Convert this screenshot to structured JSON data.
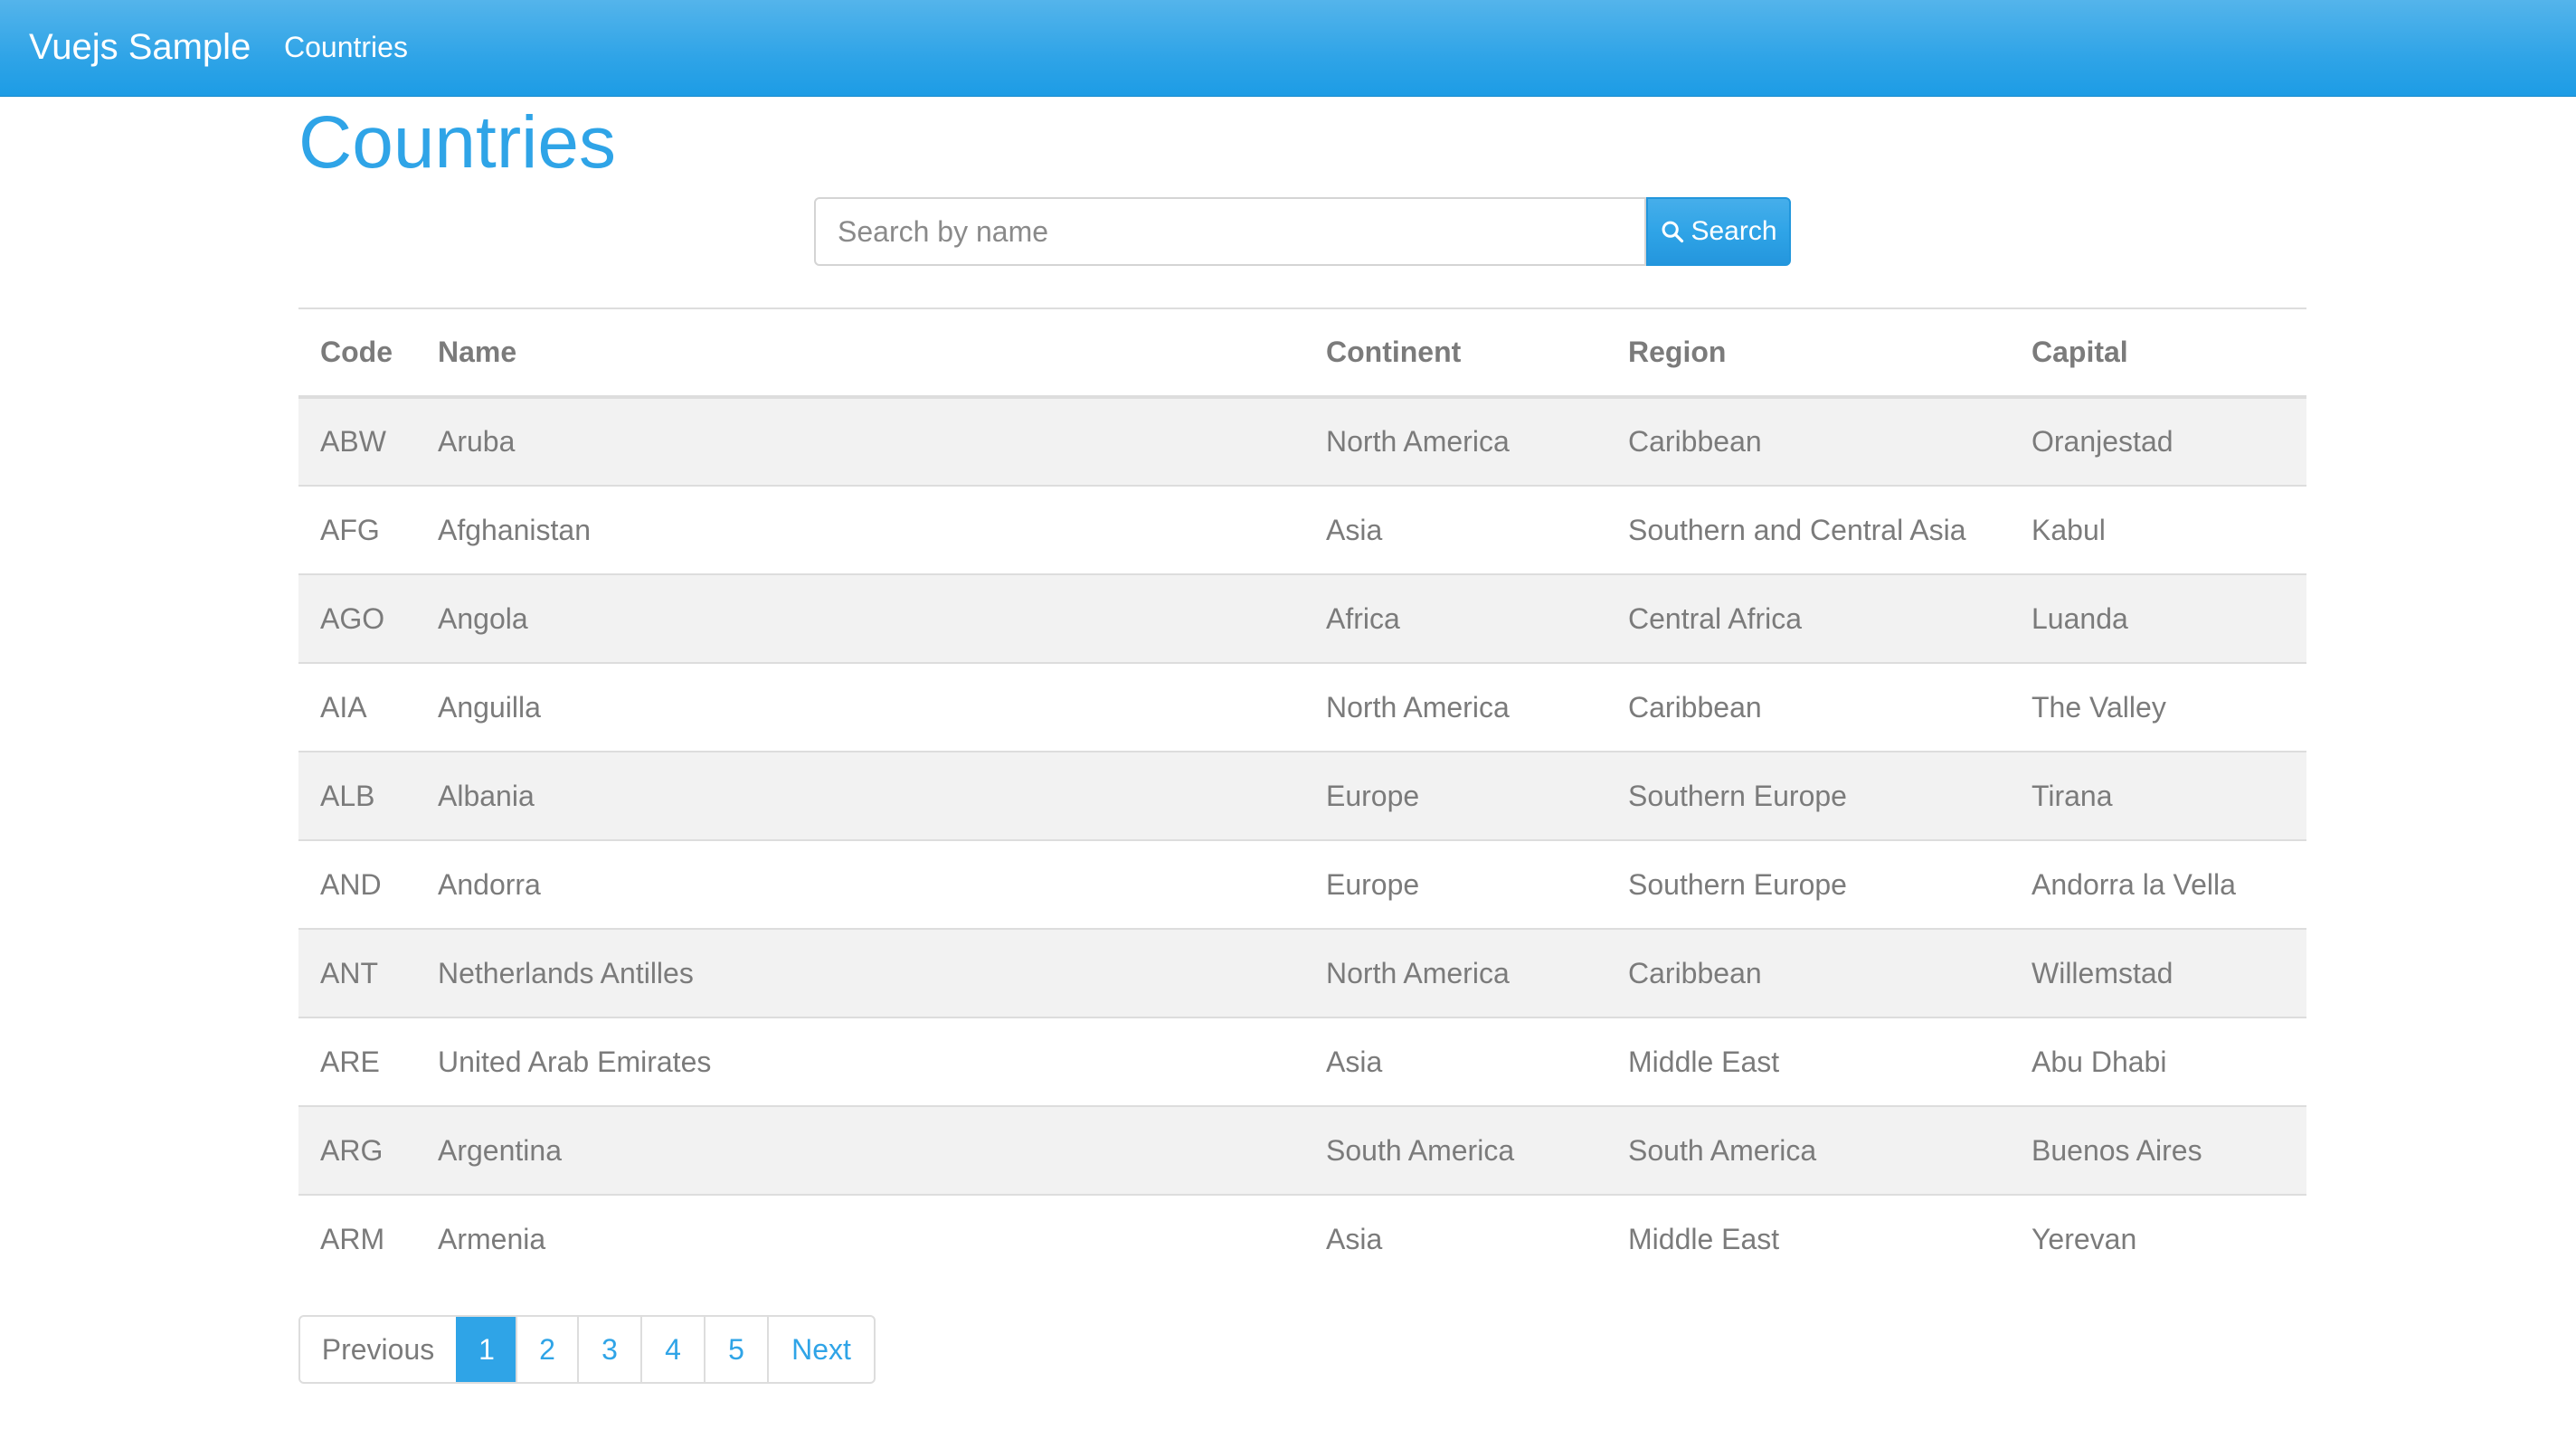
{
  "navbar": {
    "brand": "Vuejs Sample",
    "links": [
      "Countries"
    ]
  },
  "page": {
    "title": "Countries"
  },
  "search": {
    "placeholder": "Search by name",
    "value": "",
    "button_label": "Search",
    "button_icon": "search-icon"
  },
  "table": {
    "columns": [
      "Code",
      "Name",
      "Continent",
      "Region",
      "Capital"
    ],
    "rows": [
      [
        "ABW",
        "Aruba",
        "North America",
        "Caribbean",
        "Oranjestad"
      ],
      [
        "AFG",
        "Afghanistan",
        "Asia",
        "Southern and Central Asia",
        "Kabul"
      ],
      [
        "AGO",
        "Angola",
        "Africa",
        "Central Africa",
        "Luanda"
      ],
      [
        "AIA",
        "Anguilla",
        "North America",
        "Caribbean",
        "The Valley"
      ],
      [
        "ALB",
        "Albania",
        "Europe",
        "Southern Europe",
        "Tirana"
      ],
      [
        "AND",
        "Andorra",
        "Europe",
        "Southern Europe",
        "Andorra la Vella"
      ],
      [
        "ANT",
        "Netherlands Antilles",
        "North America",
        "Caribbean",
        "Willemstad"
      ],
      [
        "ARE",
        "United Arab Emirates",
        "Asia",
        "Middle East",
        "Abu Dhabi"
      ],
      [
        "ARG",
        "Argentina",
        "South America",
        "South America",
        "Buenos Aires"
      ],
      [
        "ARM",
        "Armenia",
        "Asia",
        "Middle East",
        "Yerevan"
      ]
    ]
  },
  "pagination": {
    "previous": "Previous",
    "pages": [
      "1",
      "2",
      "3",
      "4",
      "5"
    ],
    "active": "1",
    "next": "Next"
  },
  "colors": {
    "accent": "#2fa4e7",
    "text": "#7b7b7b",
    "stripe": "#f2f2f2",
    "border": "#dddddd"
  }
}
